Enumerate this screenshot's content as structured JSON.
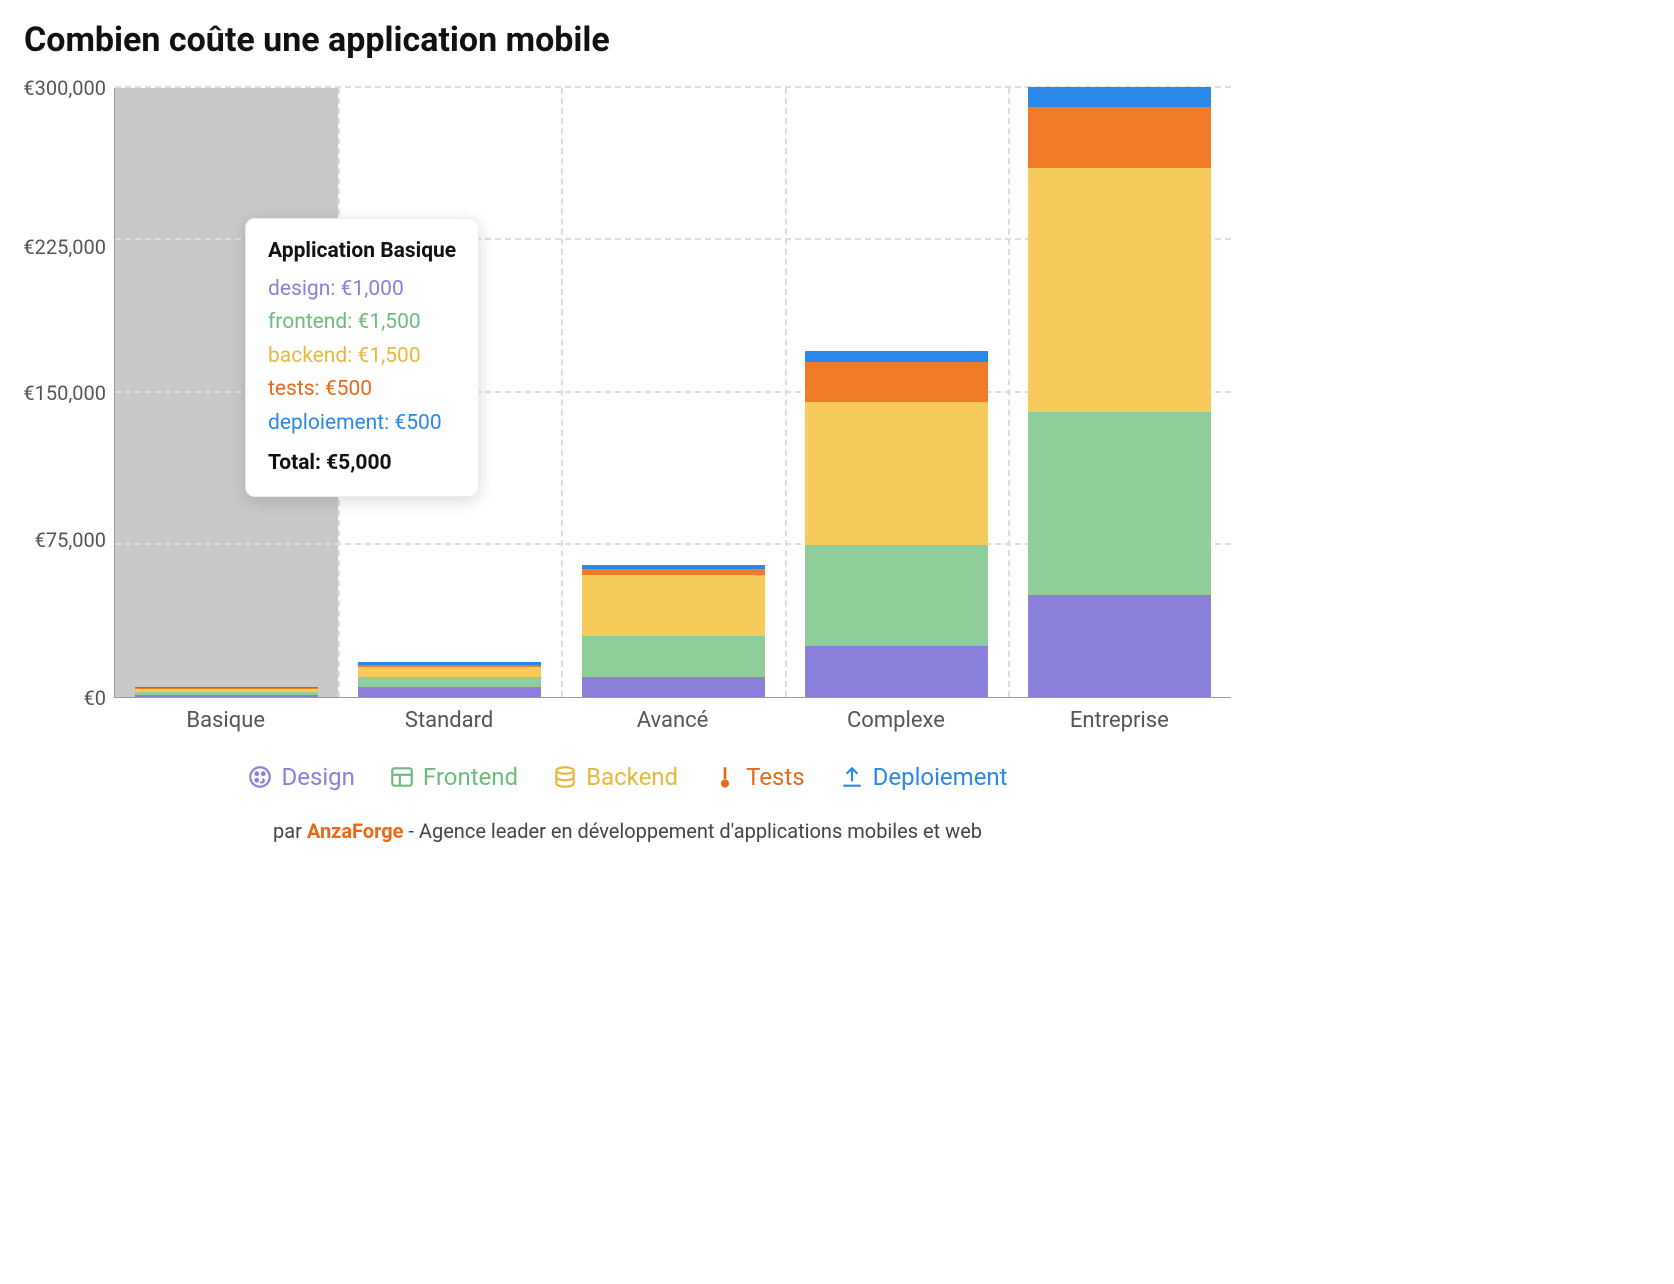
{
  "title": "Combien coûte une application mobile",
  "chart_data": {
    "type": "bar",
    "stacked": true,
    "categories": [
      "Basique",
      "Standard",
      "Avancé",
      "Complexe",
      "Entreprise"
    ],
    "series": [
      {
        "name": "Design",
        "key": "design",
        "color": "#8b80d9",
        "values": [
          1000,
          5000,
          10000,
          25000,
          50000
        ]
      },
      {
        "name": "Frontend",
        "key": "frontend",
        "color": "#8fce9a",
        "values": [
          1500,
          5000,
          20000,
          50000,
          90000
        ]
      },
      {
        "name": "Backend",
        "key": "backend",
        "color": "#f5cc5b",
        "values": [
          1500,
          5000,
          30000,
          70000,
          120000
        ]
      },
      {
        "name": "Tests",
        "key": "tests",
        "color": "#f07b28",
        "values": [
          500,
          1000,
          3000,
          20000,
          30000
        ]
      },
      {
        "name": "Deploiement",
        "key": "deploiement",
        "color": "#2a88e8",
        "values": [
          500,
          1000,
          2000,
          5000,
          10000
        ]
      }
    ],
    "yticks": [
      0,
      75000,
      150000,
      225000,
      300000
    ],
    "ylim": [
      0,
      300000
    ],
    "ytick_format": "€",
    "currency": "€"
  },
  "y_labels": [
    "€300,000",
    "€225,000",
    "€150,000",
    "€75,000",
    "€0"
  ],
  "legend": {
    "design": "Design",
    "frontend": "Frontend",
    "backend": "Backend",
    "tests": "Tests",
    "deploiement": "Deploiement"
  },
  "tooltip": {
    "title": "Application Basique",
    "lines": {
      "design": "design: €1,000",
      "frontend": "frontend: €1,500",
      "backend": "backend: €1,500",
      "tests": "tests: €500",
      "deploiement": "deploiement: €500"
    },
    "total": "Total: €5,000"
  },
  "footer": {
    "prefix": "par ",
    "brand": "AnzaForge",
    "suffix": " - Agence leader en développement d'applications mobiles et web"
  }
}
